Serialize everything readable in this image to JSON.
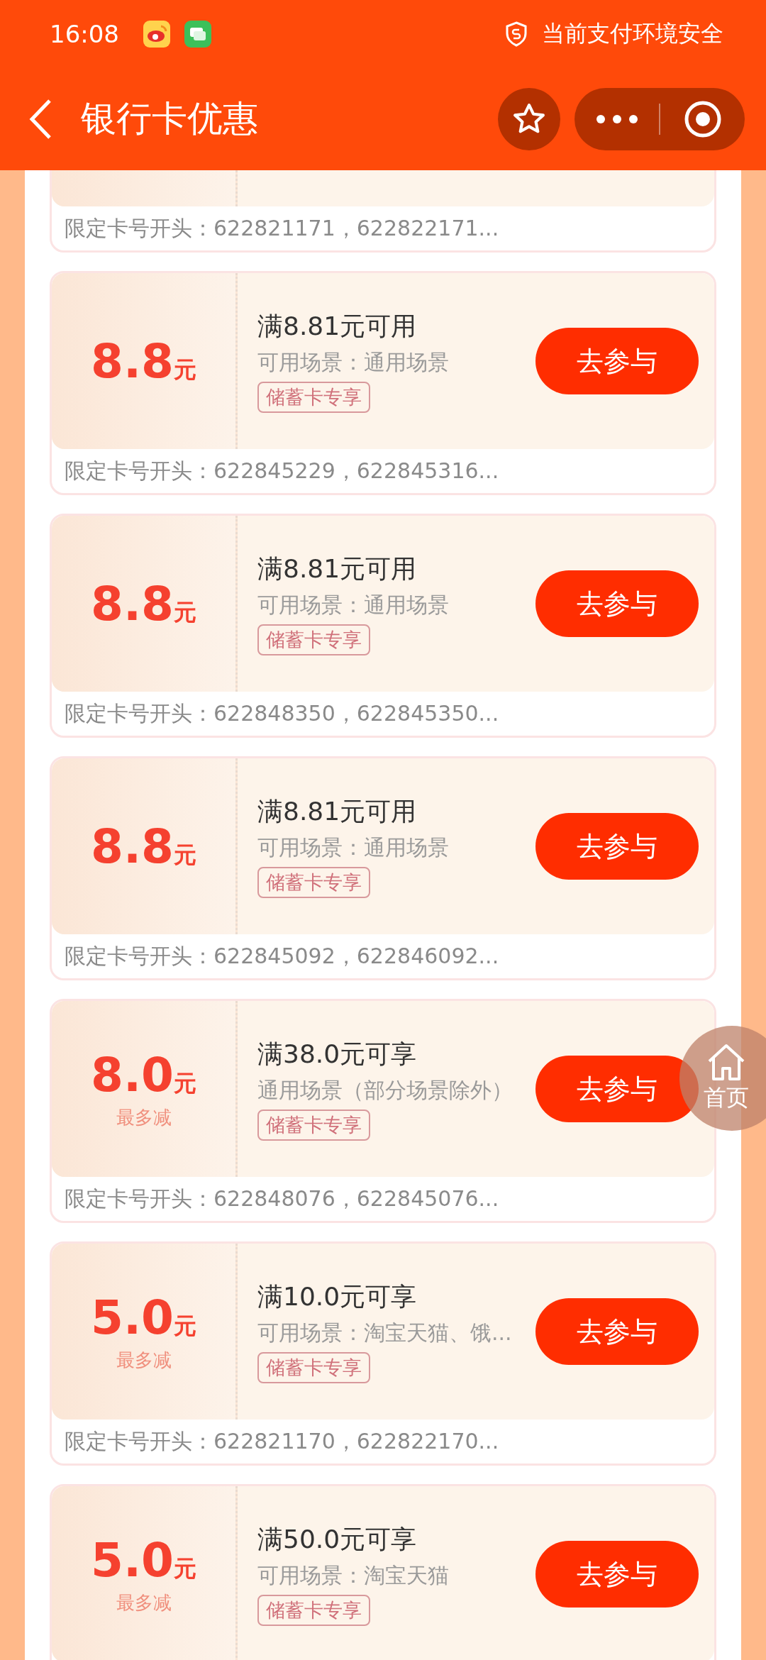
{
  "status_bar": {
    "time": "16:08",
    "security_text": "当前支付环境安全"
  },
  "header": {
    "title": "银行卡优惠"
  },
  "top_partial_coupon": {
    "card_prefixes": "限定卡号开头：622821171，622822171..."
  },
  "coupons": [
    {
      "amount": "8.8",
      "unit": "元",
      "condition": "满8.81元可用",
      "scene": "可用场景：通用场景",
      "tag": "储蓄卡专享",
      "button": "去参与",
      "card_prefixes": "限定卡号开头：622845229，622845316..."
    },
    {
      "amount": "8.8",
      "unit": "元",
      "condition": "满8.81元可用",
      "scene": "可用场景：通用场景",
      "tag": "储蓄卡专享",
      "button": "去参与",
      "card_prefixes": "限定卡号开头：622848350，622845350..."
    },
    {
      "amount": "8.8",
      "unit": "元",
      "condition": "满8.81元可用",
      "scene": "可用场景：通用场景",
      "tag": "储蓄卡专享",
      "button": "去参与",
      "card_prefixes": "限定卡号开头：622845092，622846092..."
    },
    {
      "amount": "8.0",
      "unit": "元",
      "cap_label": "最多减",
      "condition": "满38.0元可享",
      "scene": "通用场景（部分场景除外）",
      "tag": "储蓄卡专享",
      "button": "去参与",
      "card_prefixes": "限定卡号开头：622848076，622845076..."
    },
    {
      "amount": "5.0",
      "unit": "元",
      "cap_label": "最多减",
      "condition": "满10.0元可享",
      "scene": "可用场景：淘宝天猫、饿...",
      "tag": "储蓄卡专享",
      "button": "去参与",
      "card_prefixes": "限定卡号开头：622821170，622822170..."
    },
    {
      "amount": "5.0",
      "unit": "元",
      "cap_label": "最多减",
      "condition": "满50.0元可享",
      "scene": "可用场景：淘宝天猫",
      "tag": "储蓄卡专享",
      "button": "去参与"
    }
  ],
  "home_button": {
    "label": "首页"
  }
}
